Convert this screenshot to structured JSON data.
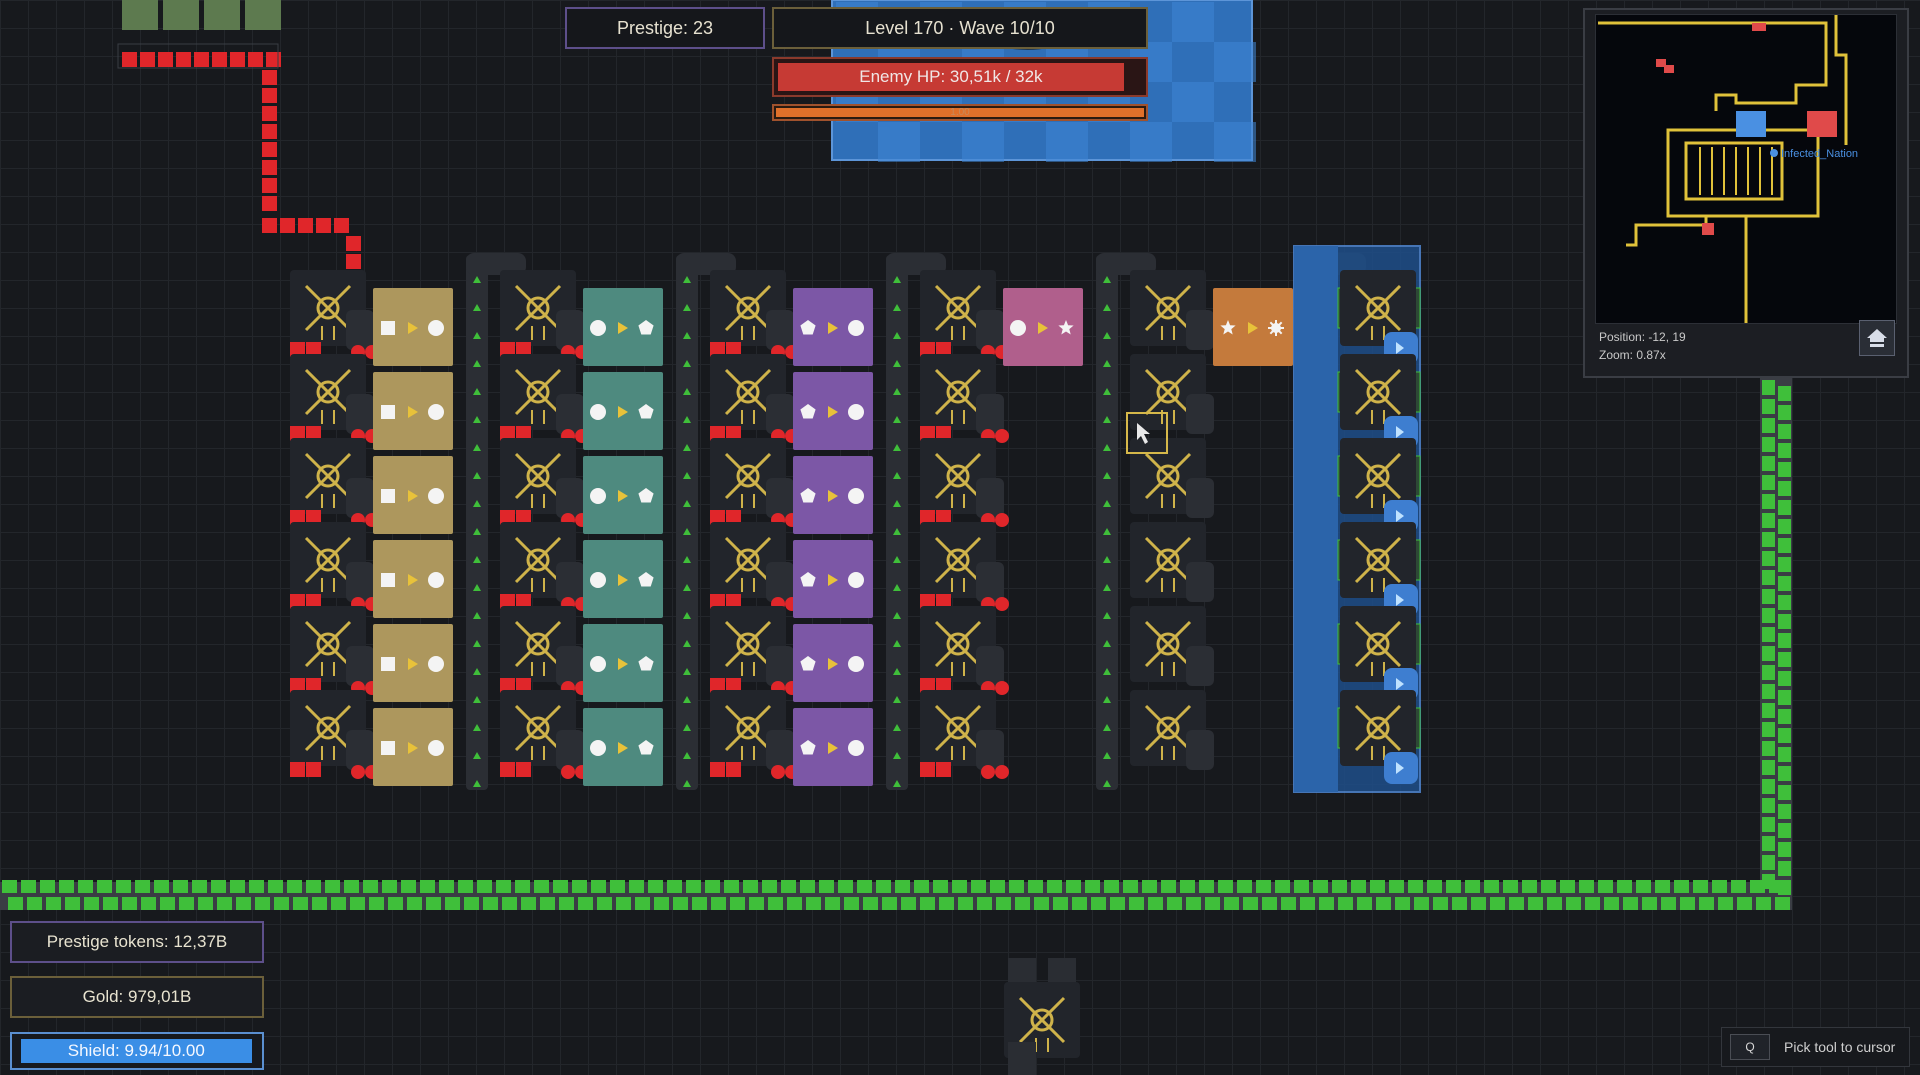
{
  "hud": {
    "prestige": "Prestige: 23",
    "level_wave": "Level 170 · Wave 10/10",
    "enemy_hp": "Enemy HP: 30,51k / 32k",
    "enemy_hp_fraction": 0.95,
    "wave_progress_label": "1.00",
    "wave_progress": 1.0
  },
  "minimap": {
    "player_label": "Infected_Nation",
    "position": "Position: -12, 19",
    "zoom": "Zoom: 0.87x",
    "home_icon": "home-icon"
  },
  "resources": {
    "prestige_tokens": "Prestige tokens: 12,37B",
    "gold": "Gold: 979,01B",
    "shield": "Shield: 9.94/10.00",
    "shield_fraction": 0.994
  },
  "tool_hint": {
    "key": "Q",
    "label": "Pick tool to cursor"
  },
  "factory_columns": [
    {
      "color": "#ad975d",
      "input": "square",
      "output": "circle"
    },
    {
      "color": "#4e8a7f",
      "input": "circle",
      "output": "pentagon"
    },
    {
      "color": "#7c57a6",
      "input": "pentagon",
      "output": "circle"
    },
    {
      "color": "#b05f8c",
      "input": "circle",
      "output": "star"
    },
    {
      "color": "#c47a3c",
      "input": "star",
      "output": "sun"
    }
  ],
  "colors": {
    "background": "#17191d",
    "belt": "#3a3d44",
    "enemy": "#e0262a",
    "green_item": "#3fbf3a",
    "accent_gold": "#d6b84a",
    "shield_blue": "#3a8ee6"
  }
}
